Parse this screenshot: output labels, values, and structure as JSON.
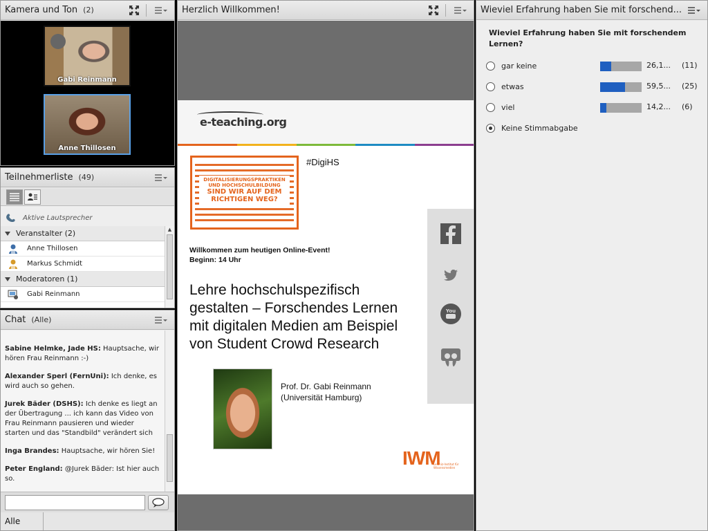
{
  "camera": {
    "title": "Kamera und Ton",
    "count": "(2)",
    "videos": [
      {
        "name": "Gabi Reinmann"
      },
      {
        "name": "Anne Thillosen"
      }
    ]
  },
  "attendees": {
    "title": "Teilnehmerliste",
    "count": "(49)",
    "active_speakers": "Aktive Lautsprecher",
    "groups": [
      {
        "label": "Veranstalter (2)",
        "members": [
          "Anne Thillosen",
          "Markus Schmidt"
        ]
      },
      {
        "label": "Moderatoren (1)",
        "members": [
          "Gabi Reinmann"
        ]
      }
    ]
  },
  "chat": {
    "title": "Chat",
    "scope": "(Alle)",
    "messages": [
      {
        "author": "Sabine Helmke, Jade HS:",
        "text": "Hauptsache, wir hören Frau Reinmann :-)"
      },
      {
        "author": "Alexander Sperl (FernUni):",
        "text": "Ich denke, es wird auch so gehen."
      },
      {
        "author": "Jurek Bäder (DSHS):",
        "text": "Ich denke es liegt an der Übertragung ... ich kann das Video von Frau Reinmann pausieren und wieder starten und das \"Standbild\" verändert sich"
      },
      {
        "author": "Inga Brandes:",
        "text": "Hauptsache, wir hören Sie!"
      },
      {
        "author": "Peter England:",
        "text": "@Jurek Bäder: Ist hier auch so."
      }
    ],
    "input_value": "",
    "target": "Alle"
  },
  "share": {
    "title": "Herzlich Willkommen!",
    "slide": {
      "logo": "e-teaching.org",
      "maze_line1": "DIGITALISIERUNGSPRAKTIKEN",
      "maze_line2": "UND HOCHSCHULBILDUNG",
      "maze_line3": "SIND WIR AUF DEM",
      "maze_line4": "RICHTIGEN WEG?",
      "hashtag": "#DigiHS",
      "welcome_line1": "Willkommen zum heutigen Online-Event!",
      "welcome_line2": "Beginn: 14 Uhr",
      "title_lines": [
        "Lehre hochschulspezifisch",
        "gestalten – Forschendes Lernen",
        "mit digitalen Medien am Beispiel",
        "von Student Crowd Research"
      ],
      "speaker_line1": "Prof. Dr. Gabi Reinmann",
      "speaker_line2": "(Universität Hamburg)",
      "iwm_logo": "IWM",
      "iwm_sub": "Leibniz-Institut für Wissensmedien",
      "social_icons": [
        "facebook-icon",
        "twitter-icon",
        "youtube-icon",
        "slideshare-icon"
      ]
    }
  },
  "poll": {
    "title": "Wieviel Erfahrung haben Sie mit forschend...",
    "question": "Wieviel Erfahrung haben Sie mit forschendem Lernen?",
    "options": [
      {
        "label": "gar keine",
        "percent": "26,1...",
        "count": "(11)",
        "fraction": 0.261
      },
      {
        "label": "etwas",
        "percent": "59,5...",
        "count": "(25)",
        "fraction": 0.595
      },
      {
        "label": "viel",
        "percent": "14,2...",
        "count": "(6)",
        "fraction": 0.142
      }
    ],
    "abstain_label": "Keine Stimmabgabe",
    "selected": "abstain"
  },
  "colors": {
    "accent_blue": "#1f5fc0",
    "orange": "#e4641d",
    "slide_bar": [
      "#e4641d",
      "#f2b21c",
      "#7dba3a",
      "#1e8bc3",
      "#8c3e8f"
    ]
  }
}
